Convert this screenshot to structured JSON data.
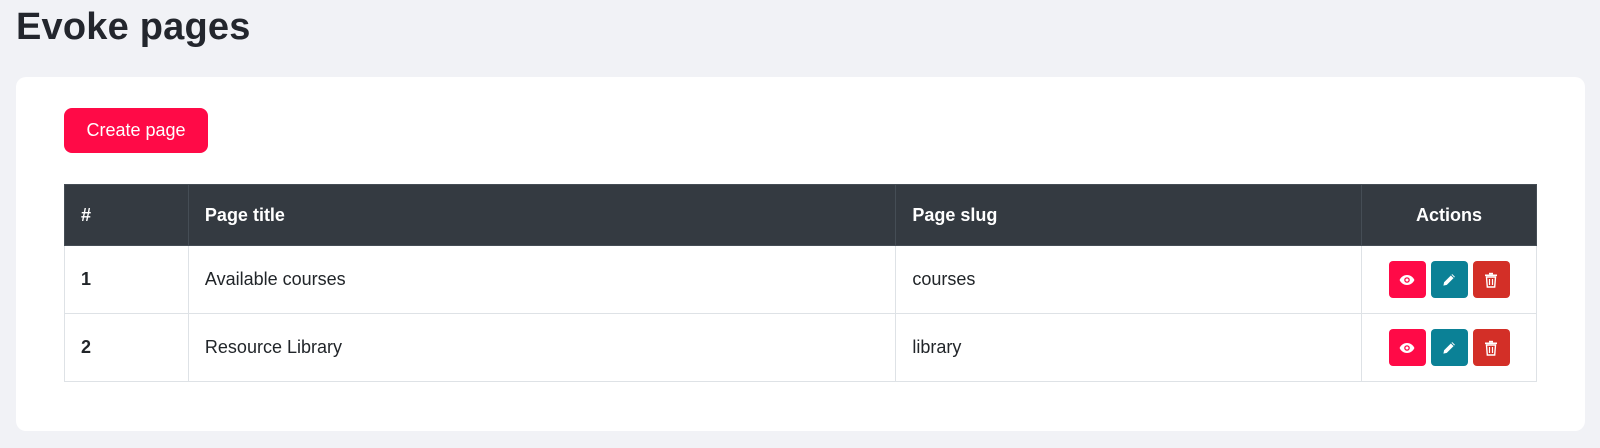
{
  "page": {
    "title": "Evoke pages"
  },
  "toolbar": {
    "create_label": "Create page"
  },
  "table": {
    "headers": {
      "index": "#",
      "title": "Page title",
      "slug": "Page slug",
      "actions": "Actions"
    },
    "rows": [
      {
        "index": "1",
        "title": "Available courses",
        "slug": "courses"
      },
      {
        "index": "2",
        "title": "Resource Library",
        "slug": "library"
      }
    ]
  },
  "icons": {
    "view": "eye-icon",
    "edit": "pencil-icon",
    "delete": "trash-icon"
  },
  "colors": {
    "primary": "#ff0a47",
    "edit": "#0b8196",
    "delete": "#d32f27",
    "header_bg": "#343a41"
  }
}
